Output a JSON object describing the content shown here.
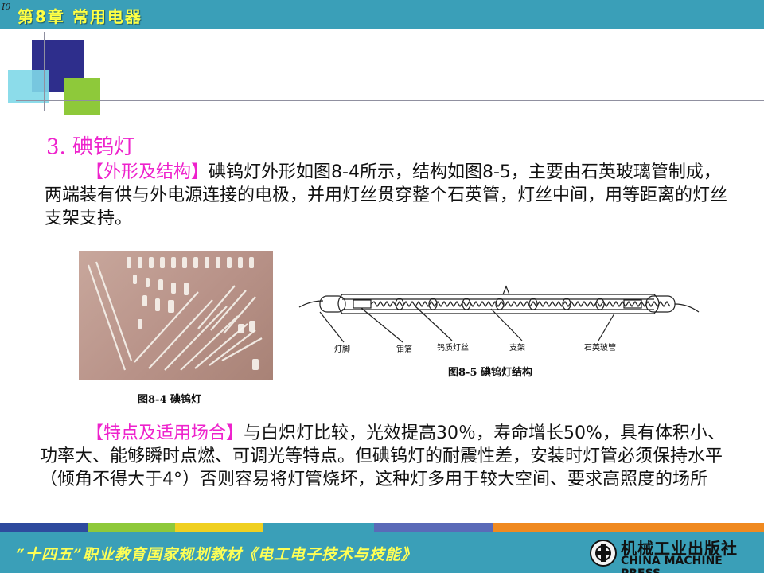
{
  "header": {
    "corner_mark": "I0",
    "chapter_title": "第8章   常用电器",
    "bg_color": "#3a9fb8",
    "title_color": "#ffff44"
  },
  "section": {
    "title": "3. 碘钨灯",
    "para1_tag": "【外形及结构】",
    "para1_text": "碘钨灯外形如图8-4所示，结构如图8-5，主要由石英玻璃管制成，两端装有供与外电源连接的电极，并用灯丝贯穿整个石英管，灯丝中间，用等距离的灯丝支架支持。",
    "para2_tag": "【特点及适用场合】",
    "para2_text": "与白炽灯比较，光效提高30％，寿命增长50%，具有体积小、功率大、能够瞬时点燃、可调光等特点。但碘钨灯的耐震性差，安装时灯管必须保持水平（倾角不得大于4°）否则容易将灯管烧坏，这种灯多用于较大空间、要求高照度的场所",
    "highlight_color": "#ee22cc"
  },
  "figure4": {
    "caption": "图8-4 碘钨灯"
  },
  "figure5": {
    "caption": "图8-5 碘钨灯结构",
    "labels": {
      "lamp_base": "灯脚",
      "molybdenum_foil": "钼箔",
      "tungsten_filament": "钨质灯丝",
      "support": "支架",
      "quartz_tube": "石英玻管"
    }
  },
  "footer": {
    "series_title": "“十四五”职业教育国家规划教材《电工电子技术与技能》",
    "publisher_cn": "机械工业出版社",
    "publisher_en": "CHINA MACHINE PRESS",
    "strip_colors": [
      "#2e4a9e",
      "#8ec93a",
      "#f0d020",
      "#3a9fb8",
      "#f08a20",
      "#5a6ab8"
    ]
  }
}
